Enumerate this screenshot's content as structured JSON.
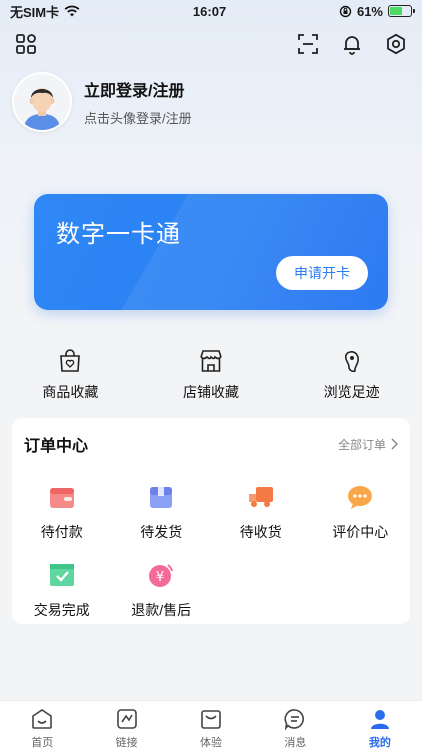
{
  "status_bar": {
    "carrier": "无SIM卡",
    "time": "16:07",
    "battery": "61%",
    "battery_level": 0.61
  },
  "profile": {
    "title": "立即登录/注册",
    "subtitle": "点击头像登录/注册"
  },
  "card": {
    "title": "数字一卡通",
    "button": "申请开卡"
  },
  "favorites": [
    {
      "label": "商品收藏",
      "icon": "shopping-bag-heart-icon"
    },
    {
      "label": "店铺收藏",
      "icon": "store-icon"
    },
    {
      "label": "浏览足迹",
      "icon": "footprint-icon"
    }
  ],
  "orders": {
    "title": "订单中心",
    "all": "全部订单",
    "items": [
      {
        "label": "待付款",
        "icon": "wallet-icon",
        "color": "#f06a6a"
      },
      {
        "label": "待发货",
        "icon": "package-icon",
        "color": "#7b8cf0"
      },
      {
        "label": "待收货",
        "icon": "truck-icon",
        "color": "#f5743f"
      },
      {
        "label": "评价中心",
        "icon": "comment-bubble-icon",
        "color": "#f7a13a"
      },
      {
        "label": "交易完成",
        "icon": "check-box-icon",
        "color": "#4fcf94"
      },
      {
        "label": "退款/售后",
        "icon": "refund-icon",
        "color": "#f45c8c"
      }
    ]
  },
  "tabbar": [
    {
      "label": "首页",
      "icon": "home-icon",
      "active": false
    },
    {
      "label": "链接",
      "icon": "link-icon",
      "active": false
    },
    {
      "label": "体验",
      "icon": "experience-icon",
      "active": false
    },
    {
      "label": "消息",
      "icon": "message-icon",
      "active": false
    },
    {
      "label": "我的",
      "icon": "user-icon",
      "active": true
    }
  ],
  "colors": {
    "accent": "#2a7df3",
    "tab_active": "#2a6cf0"
  }
}
